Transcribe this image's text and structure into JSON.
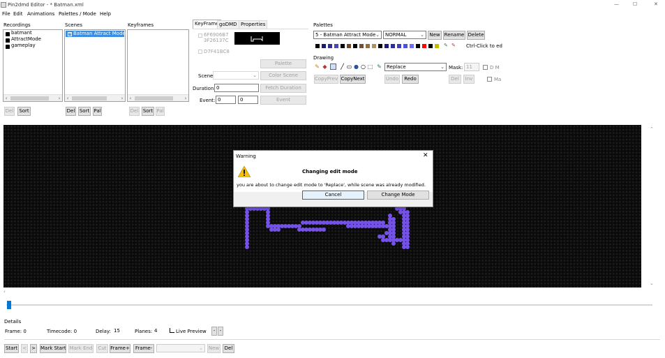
{
  "window": {
    "title": "Pin2dmd Editor - * Batman.xml",
    "controls": {
      "minimize": "—",
      "maximize": "☐",
      "close": "✕"
    }
  },
  "menu": [
    "File",
    "Edit",
    "Animations",
    "Palettes / Mode",
    "Help"
  ],
  "recordings": {
    "header": "Recordings",
    "items": [
      "batmant",
      "AttractMode",
      "gameplay"
    ],
    "buttons": [
      "Del",
      "Sort"
    ]
  },
  "scenes": {
    "header": "Scenes",
    "items": [
      "Batman Attract Mode"
    ],
    "buttons": [
      "Del",
      "Sort",
      "Pal"
    ]
  },
  "keyframes": {
    "header": "Keyframes",
    "buttons": [
      "Del",
      "Sort",
      "Pal"
    ]
  },
  "tabs": [
    "KeyFrame",
    "goDMD",
    "Properties"
  ],
  "keyframe": {
    "hashes": [
      "6F6906B7",
      "3F26137C",
      "D7F41BC8"
    ],
    "buttons": {
      "palette": "Palette",
      "color_scene": "Color Scene",
      "fetch_duration": "Fetch Duration",
      "event": "Event"
    },
    "labels": {
      "scene": "Scene:",
      "duration": "Duration:",
      "event": "Event:"
    },
    "values": {
      "duration": "0",
      "event1": "0",
      "event2": "0"
    }
  },
  "palettes": {
    "header": "Palettes",
    "selected": "5 - Batman Attract Mode",
    "type": "NORMAL",
    "buttons": [
      "New",
      "Rename",
      "Delete"
    ],
    "hint": "Ctrl-Click to ed",
    "colors": [
      "#000000",
      "#1a1a6e",
      "#303090",
      "#4848b4",
      "#000000",
      "#6a4a2a",
      "#000000",
      "#705030",
      "#907040",
      "#b09060",
      "#000000",
      "#1a1a7e",
      "#2c2c9e",
      "#3e3ebe",
      "#5050e0",
      "#6c6cff",
      "#000000",
      "#ff0000",
      "#000000",
      "#c0c000"
    ]
  },
  "drawing": {
    "header": "Drawing",
    "mode": "Replace",
    "mask_label": "Mask:",
    "mask_value": "11",
    "checkboxes": [
      "D M",
      "Ma"
    ],
    "buttons": {
      "copy_prev": "CopyPrev",
      "copy_next": "CopyNext",
      "undo": "Undo",
      "redo": "Redo",
      "del": "Del",
      "inv": "Inv"
    }
  },
  "dialog": {
    "title": "Warning",
    "heading": "Changing edit mode",
    "message": "you are about to change edit mode to 'Replace', while scene was already modified.",
    "buttons": {
      "cancel": "Cancel",
      "change": "Change Mode"
    }
  },
  "details": {
    "header": "Details",
    "frame": "Frame: 0",
    "timecode": "Timecode: 0",
    "delay_label": "Delay:",
    "delay_value": "15",
    "planes_label": "Planes:",
    "planes_value": "4",
    "live_preview": "Live Preview"
  },
  "bottom_bar": {
    "start": "Start",
    "prev": "<",
    "next": ">",
    "mark_start": "Mark Start",
    "mark_end": "Mark End",
    "cut": "Cut",
    "frame_plus": "Frame+",
    "frame_minus": "Frame-",
    "new": "New",
    "del": "Del"
  },
  "dmd": {
    "pixel_color": "#7452e8",
    "bg_color": "#0a0a0a"
  }
}
